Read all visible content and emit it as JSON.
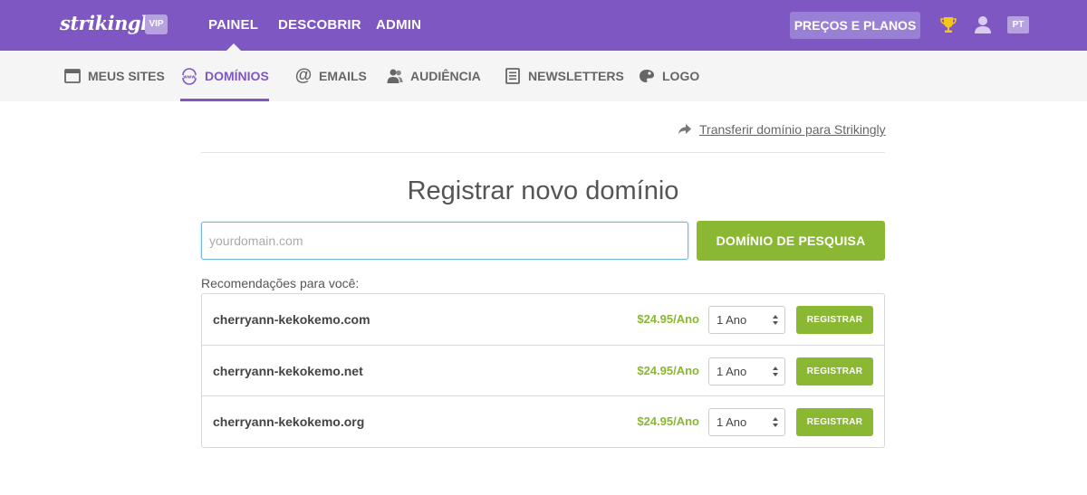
{
  "topbar": {
    "logo": "strikingly",
    "badge": "VIP",
    "nav": [
      {
        "label": "PAINEL",
        "active": true
      },
      {
        "label": "DESCOBRIR",
        "active": false
      },
      {
        "label": "ADMIN",
        "active": false
      }
    ],
    "plans_label": "PREÇOS E PLANOS",
    "lang": "PT",
    "icons": [
      "trophy-icon",
      "user-icon"
    ]
  },
  "subnav": {
    "items": [
      {
        "label": "MEUS SITES",
        "icon": "browser-window-icon",
        "active": false
      },
      {
        "label": "DOMÍNIOS",
        "icon": "www-globe-icon",
        "active": true
      },
      {
        "label": "EMAILS",
        "icon": "at-sign-icon",
        "active": false
      },
      {
        "label": "AUDIÊNCIA",
        "icon": "users-icon",
        "active": false
      },
      {
        "label": "NEWSLETTERS",
        "icon": "newsletter-icon",
        "active": false
      },
      {
        "label": "LOGO",
        "icon": "palette-icon",
        "active": false
      }
    ]
  },
  "main": {
    "transfer_link": "Transferir domínio para Strikingly",
    "title": "Registrar novo domínio",
    "search": {
      "placeholder": "yourdomain.com",
      "value": ""
    },
    "search_button": "DOMÍNIO DE PESQUISA",
    "recommendations_label": "Recomendações para você:",
    "recommendations": [
      {
        "domain": "cherryann-kekokemo.com",
        "price": "$24.95/Ano",
        "period": "1 Ano",
        "button": "REGISTRAR"
      },
      {
        "domain": "cherryann-kekokemo.net",
        "price": "$24.95/Ano",
        "period": "1 Ano",
        "button": "REGISTRAR"
      },
      {
        "domain": "cherryann-kekokemo.org",
        "price": "$24.95/Ano",
        "period": "1 Ano",
        "button": "REGISTRAR"
      }
    ]
  },
  "colors": {
    "brand_purple": "#7e57c2",
    "accent_green": "#8ab832",
    "subnav_bg": "#f5f5f5"
  }
}
